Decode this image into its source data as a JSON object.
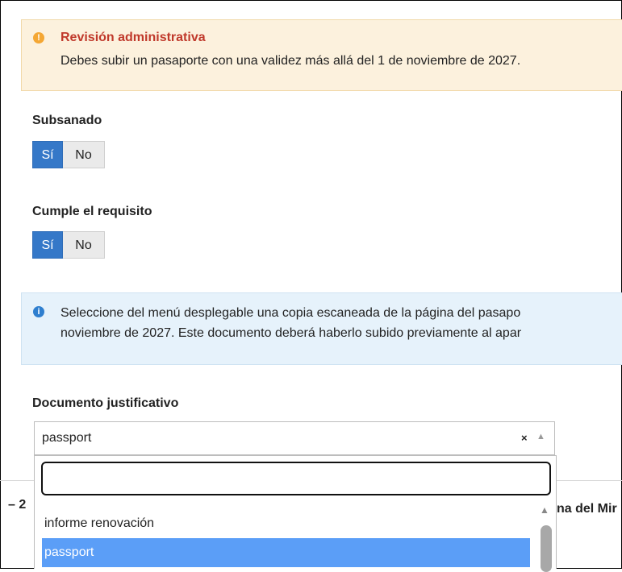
{
  "warning": {
    "icon": "warning-circle-icon",
    "title": "Revisión administrativa",
    "text": "Debes subir un pasaporte con una validez más allá del 1 de noviembre de 2027."
  },
  "fields": {
    "subsanado": {
      "label": "Subsanado",
      "yes": "Sí",
      "no": "No",
      "selected": "Sí"
    },
    "cumple": {
      "label": "Cumple el requisito",
      "yes": "Sí",
      "no": "No",
      "selected": "Sí"
    }
  },
  "info": {
    "icon": "info-circle-icon",
    "line1": "Seleccione del menú desplegable una copia escaneada de la página del pasapo",
    "line2": "noviembre de 2027. Este documento deberá haberlo subido previamente al apar"
  },
  "document": {
    "label": "Documento justificativo",
    "value": "passport",
    "clear": "×",
    "search_value": "",
    "options": [
      "informe renovación",
      "passport"
    ],
    "selected_option": "passport"
  },
  "background": {
    "left_text": "– 2",
    "right_text": "na del Mir"
  },
  "colors": {
    "warning_bg": "#fcf1dd",
    "warning_title": "#c0392b",
    "info_bg": "#e6f2fb",
    "toggle_active": "#3578c8",
    "option_selected": "#5b9ef7"
  }
}
